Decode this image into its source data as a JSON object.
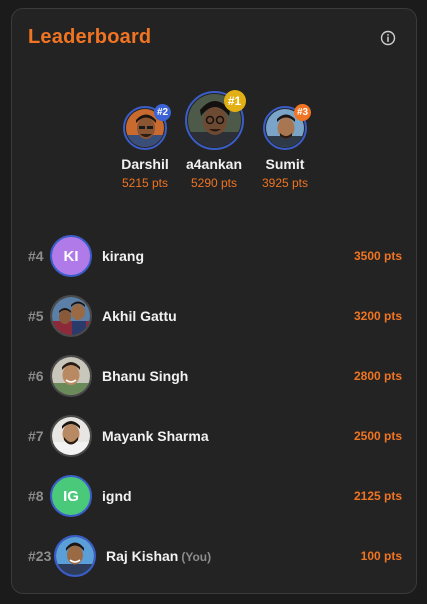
{
  "leaderboard": {
    "title": "Leaderboard",
    "info_icon": "info-icon",
    "accent_color": "#f07422",
    "podium": [
      {
        "rank_label": "#2",
        "name": "Darshil",
        "points": "5215 pts",
        "badge_color": "#3c63d6"
      },
      {
        "rank_label": "#1",
        "name": "a4ankan",
        "points": "5290 pts",
        "badge_color": "#e2b014"
      },
      {
        "rank_label": "#3",
        "name": "Sumit",
        "points": "3925 pts",
        "badge_color": "#f07422"
      }
    ],
    "list": [
      {
        "rank": "#4",
        "name": "kirang",
        "initials": "KI",
        "points": "3500 pts",
        "avatar_color": "#b07be8"
      },
      {
        "rank": "#5",
        "name": "Akhil Gattu",
        "initials": "",
        "points": "3200 pts"
      },
      {
        "rank": "#6",
        "name": "Bhanu Singh",
        "initials": "",
        "points": "2800 pts"
      },
      {
        "rank": "#7",
        "name": "Mayank Sharma",
        "initials": "",
        "points": "2500 pts"
      },
      {
        "rank": "#8",
        "name": "ignd",
        "initials": "IG",
        "points": "2125 pts",
        "avatar_color": "#4ac97a"
      },
      {
        "rank": "#23",
        "name": "Raj Kishan",
        "you_tag": "(You)",
        "initials": "",
        "points": "100 pts"
      }
    ]
  }
}
